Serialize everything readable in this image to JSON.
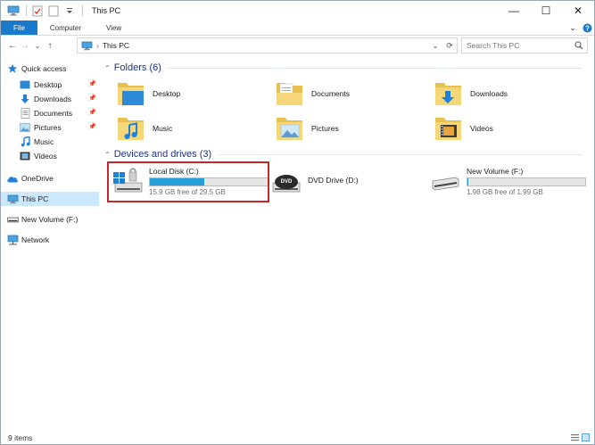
{
  "window": {
    "title": "This PC",
    "controls": {
      "minimize": "—",
      "maximize": "☐",
      "close": "✕"
    }
  },
  "ribbon": {
    "tabs": [
      {
        "label": "File"
      },
      {
        "label": "Computer"
      },
      {
        "label": "View"
      }
    ],
    "collapse_glyph": "⌄",
    "help_glyph": "?"
  },
  "address": {
    "path": "This PC",
    "separator": "›",
    "nav": {
      "back": "←",
      "forward": "→",
      "recent": "⌄",
      "up": "↑"
    },
    "dropdown": "⌄",
    "refresh": "⟳"
  },
  "search": {
    "placeholder": "Search This PC"
  },
  "sidebar": {
    "quick_access": "Quick access",
    "pinned": [
      {
        "label": "Desktop",
        "pinned": true
      },
      {
        "label": "Downloads",
        "pinned": true
      },
      {
        "label": "Documents",
        "pinned": true
      },
      {
        "label": "Pictures",
        "pinned": true
      },
      {
        "label": "Music",
        "pinned": false
      },
      {
        "label": "Videos",
        "pinned": false
      }
    ],
    "onedrive": "OneDrive",
    "this_pc": "This PC",
    "new_volume": "New Volume (F:)",
    "network": "Network"
  },
  "content": {
    "folders_header": "Folders (6)",
    "folders": [
      {
        "label": "Desktop"
      },
      {
        "label": "Documents"
      },
      {
        "label": "Downloads"
      },
      {
        "label": "Music"
      },
      {
        "label": "Pictures"
      },
      {
        "label": "Videos"
      }
    ],
    "drives_header": "Devices and drives (3)",
    "drives": [
      {
        "label": "Local Disk (C:)",
        "free_text": "15.9 GB free of 29.5 GB",
        "used_fraction": 0.46
      },
      {
        "label": "DVD Drive (D:)",
        "free_text": "",
        "used_fraction": null
      },
      {
        "label": "New Volume (F:)",
        "free_text": "1.98 GB free of 1.99 GB",
        "used_fraction": 0.01
      }
    ]
  },
  "status": {
    "items": "9 items"
  },
  "colors": {
    "accent": "#1979ca",
    "selection": "#cce8ff",
    "bar_fill": "#26a0da",
    "highlight_border": "#c62828",
    "group_header": "#1e3287"
  }
}
